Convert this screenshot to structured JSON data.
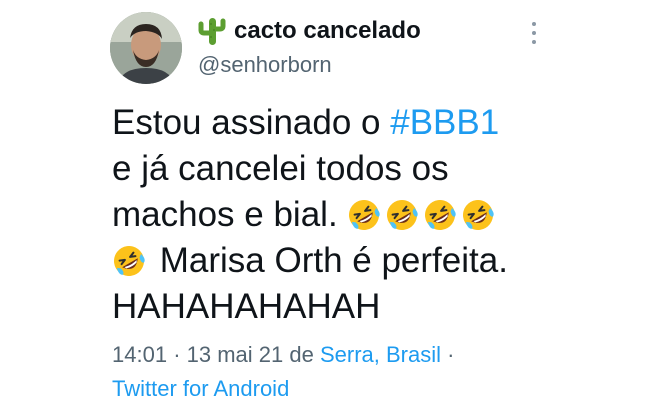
{
  "tweet": {
    "author": {
      "display_name": "cacto cancelado",
      "name_emoji": "cactus-emoji",
      "handle": "@senhorborn"
    },
    "text": {
      "line1_before": "Estou assinado o ",
      "line1_hashtag": "#BBB1",
      "line2": "e já cancelei todos os",
      "line3": "machos e bial.",
      "line4": "Marisa Orth é perfeita.",
      "line5": "HAHAHAHAHAH",
      "emoji_name": "rolling-on-the-floor-laughing"
    },
    "meta": {
      "time": "14:01",
      "dot": "·",
      "date": "13 mai 21 de",
      "location": "Serra, Brasil",
      "source": "Twitter for Android"
    },
    "colors": {
      "link": "#1d9bf0",
      "secondary": "#536471",
      "text": "#0f1419"
    }
  }
}
